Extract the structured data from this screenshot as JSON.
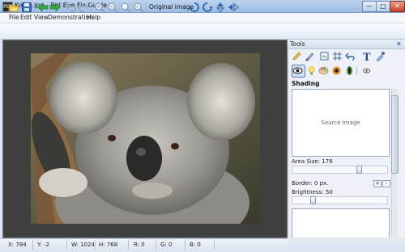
{
  "window": {
    "title": "Koala.jpg - Pet Eye Fix Guide",
    "app_icon_text": "PEF"
  },
  "menu": [
    "File",
    "Edit",
    "View",
    "Demonstration",
    "Help"
  ],
  "toolbar": {
    "original_image_label": "Original image"
  },
  "tools_panel": {
    "title": "Tools",
    "section_title": "Shading",
    "preview_text": "Source Image",
    "area_size_label": "Area Size: 176",
    "border_label": "Border: 0 px.",
    "brightness_label": "Brightness: 50",
    "border_plus": "+",
    "border_minus": "-"
  },
  "status": {
    "x": "X: 784",
    "y": "Y: -2",
    "w": "W: 1024",
    "h": "H: 768",
    "r": "R: 0",
    "g": "G: 0",
    "b": "B: 0"
  },
  "colors": {
    "accent": "#1b4f9a",
    "canvas_bg": "#3f3f3f"
  }
}
